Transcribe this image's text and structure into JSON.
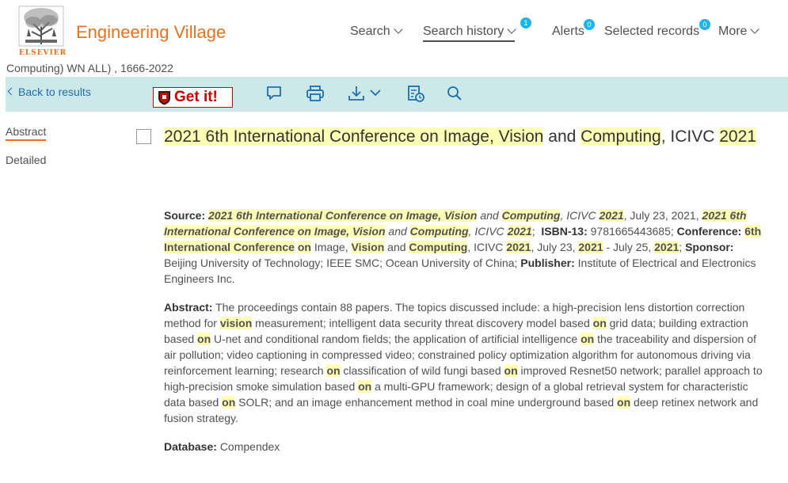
{
  "header": {
    "logo_text": "ELSEVIER",
    "brand": "Engineering Village",
    "nav": [
      {
        "label": "Search",
        "badge": null
      },
      {
        "label": "Search history",
        "badge": "1"
      },
      {
        "label": "Alerts",
        "badge": "0"
      },
      {
        "label": "Selected records",
        "badge": "0"
      },
      {
        "label": "More",
        "badge": null
      }
    ]
  },
  "subline": "Computing) WN ALL) , 1666-2022",
  "toolbar": {
    "back_label": "Back to results",
    "getit_label": "Get it!",
    "icons": [
      "comment-icon",
      "print-icon",
      "download-icon",
      "history-icon",
      "search-icon"
    ]
  },
  "side_nav": [
    "Abstract",
    "Detailed"
  ],
  "record": {
    "title_parts": [
      {
        "t": "2021 6th International Conference on Image, Vision",
        "hl": true
      },
      {
        "t": " and ",
        "hl": false
      },
      {
        "t": "Computing",
        "hl": true
      },
      {
        "t": ", ICIVC ",
        "hl": false
      },
      {
        "t": "2021",
        "hl": true
      }
    ],
    "source_label": "Source:",
    "source_title": "2021 6th International Conference on Image, Vision",
    "source_and": "and",
    "source_computing": "Computing",
    "source_icivc": ", ICIVC",
    "source_year": "2021",
    "source_date": ", July 23, 2021,",
    "source_title2": "2021 6th International Conference on Image, Vision",
    "source_and2": "and",
    "source_computing2": "Computing",
    "source_icivc2": ", ICIVC",
    "source_year2": "2021",
    "isbn_label": "ISBN-13:",
    "isbn": "9781665443685",
    "conference_label": "Conference:",
    "conf_a": "6th International Conference",
    "conf_on": "on",
    "conf_image": "Image,",
    "conf_vision": "Vision",
    "conf_and": "and",
    "conf_computing": "Computing",
    "conf_icivc": ", ICIVC",
    "conf_year": "2021",
    "conf_date1": ", July 23,",
    "conf_year2": "2021",
    "conf_date2": "- July 25,",
    "conf_year3": "2021",
    "sponsor_label": "Sponsor:",
    "sponsor": "Beijing University of Technology; IEEE SMC; Ocean University of China;",
    "publisher_label": "Publisher:",
    "publisher": "Institute of Electrical and Electronics Engineers Inc.",
    "abstract_label": "Abstract:",
    "abstract_parts": [
      {
        "t": "The proceedings contain 88 papers. The topics discussed include: a high-precision lens distortion correction method for ",
        "hl": false
      },
      {
        "t": "vision",
        "hl": true
      },
      {
        "t": " measurement; intelligent data security threat discovery model based ",
        "hl": false
      },
      {
        "t": "on",
        "hl": true
      },
      {
        "t": " grid data; building extraction based ",
        "hl": false
      },
      {
        "t": "on",
        "hl": true
      },
      {
        "t": " U-net and conditional random fields; the application of artificial intelligence ",
        "hl": false
      },
      {
        "t": "on",
        "hl": true
      },
      {
        "t": " the traceability and dispersion of air pollution; video captioning in compressed video; constrained policy optimization algorithm for autonomous driving via reinforcement learning; research ",
        "hl": false
      },
      {
        "t": "on",
        "hl": true
      },
      {
        "t": " classification of wild fungi based ",
        "hl": false
      },
      {
        "t": "on",
        "hl": true
      },
      {
        "t": " improved Resnet50 network; parallel approach to high-precision smoke simulation based ",
        "hl": false
      },
      {
        "t": "on",
        "hl": true
      },
      {
        "t": " a multi-GPU framework; design of a global retrieval system for characteristic data based ",
        "hl": false
      },
      {
        "t": "on",
        "hl": true
      },
      {
        "t": " SOLR; and an image enhancement method in coal mine underground based ",
        "hl": false
      },
      {
        "t": "on",
        "hl": true
      },
      {
        "t": " deep retinex network and fusion strategy.",
        "hl": false
      }
    ],
    "database_label": "Database:",
    "database": "Compendex"
  },
  "colors": {
    "brand": "#e9711c",
    "toolbar_bg": "#cde8e8",
    "badge": "#1ab7ea",
    "highlight": "#ffffb6",
    "link": "#1e6fb0"
  }
}
